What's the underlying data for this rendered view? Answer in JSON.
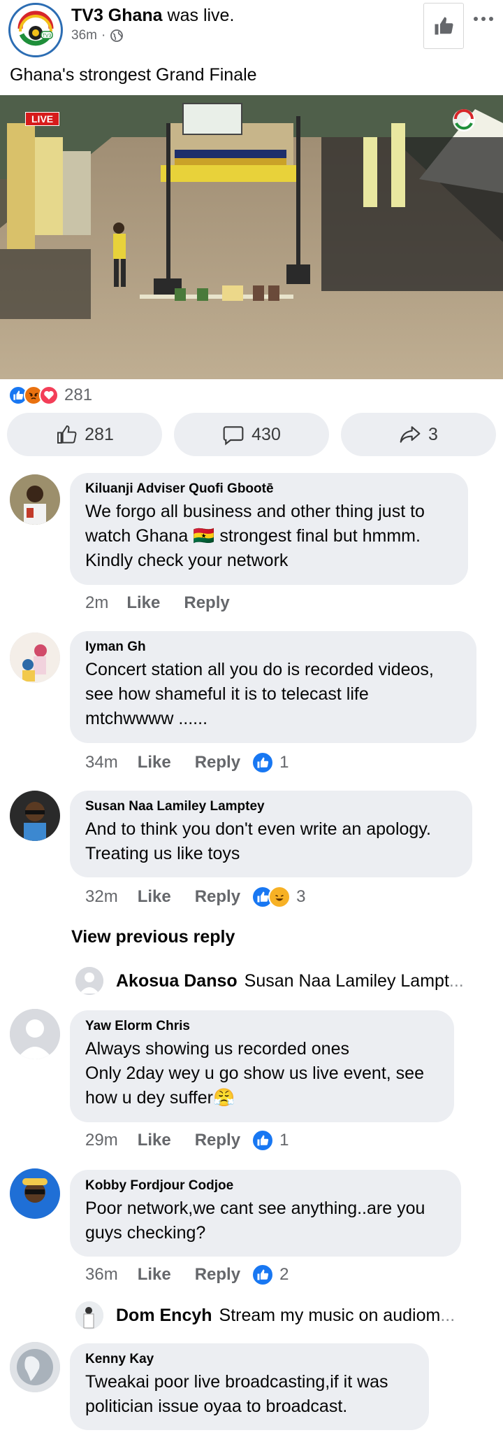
{
  "post": {
    "page_name": "TV3 Ghana",
    "action": "was live.",
    "time": "36m",
    "text": "Ghana's strongest Grand Finale"
  },
  "video": {
    "badge": "LIVE"
  },
  "reactions": {
    "count": "281",
    "icons": [
      "like-icon",
      "angry-icon",
      "love-icon"
    ]
  },
  "actions": {
    "like_count": "281",
    "comment_count": "430",
    "share_count": "3"
  },
  "comments": [
    {
      "author": "Kiluanji Adviser Quofi Gbootē",
      "text": "We forgo all business and other thing just to watch Ghana 🇬🇭 strongest final but hmmm. Kindly check your network",
      "time": "2m",
      "like": "Like",
      "reply": "Reply",
      "reaction_count": ""
    },
    {
      "author": "Iyman Gh",
      "text": "Concert station all you do is recorded videos, see how shameful it is to telecast life mtchwwww ......",
      "time": "34m",
      "like": "Like",
      "reply": "Reply",
      "reaction_count": "1"
    },
    {
      "author": "Susan Naa Lamiley Lamptey",
      "text": "And to think you don't even write an apology. Treating us like toys",
      "time": "32m",
      "like": "Like",
      "reply": "Reply",
      "reaction_count": "3"
    },
    {
      "author": "Yaw Elorm Chris",
      "text": "Always showing us recorded ones\nOnly 2day wey u go show us live event, see how u dey suffer😤",
      "time": "29m",
      "like": "Like",
      "reply": "Reply",
      "reaction_count": "1"
    },
    {
      "author": "Kobby Fordjour Codjoe",
      "text": "Poor network,we cant see anything..are you guys checking?",
      "time": "36m",
      "like": "Like",
      "reply": "Reply",
      "reaction_count": "2"
    },
    {
      "author": "Kenny Kay",
      "text": "Tweakai poor live broadcasting,if it was politician issue oyaa to broadcast.",
      "time": "",
      "like": "",
      "reply": "",
      "reaction_count": ""
    }
  ],
  "view_previous": "View previous reply",
  "replies": [
    {
      "author": "Akosua Danso",
      "text": "Susan Naa Lamiley Lampt",
      "ellipsis": "..."
    },
    {
      "author": "Dom Encyh",
      "text": "Stream my music on audiom",
      "ellipsis": "..."
    }
  ],
  "colors": {
    "accent": "#1877f2",
    "bubble": "#eceef2",
    "meta": "#65676b"
  }
}
